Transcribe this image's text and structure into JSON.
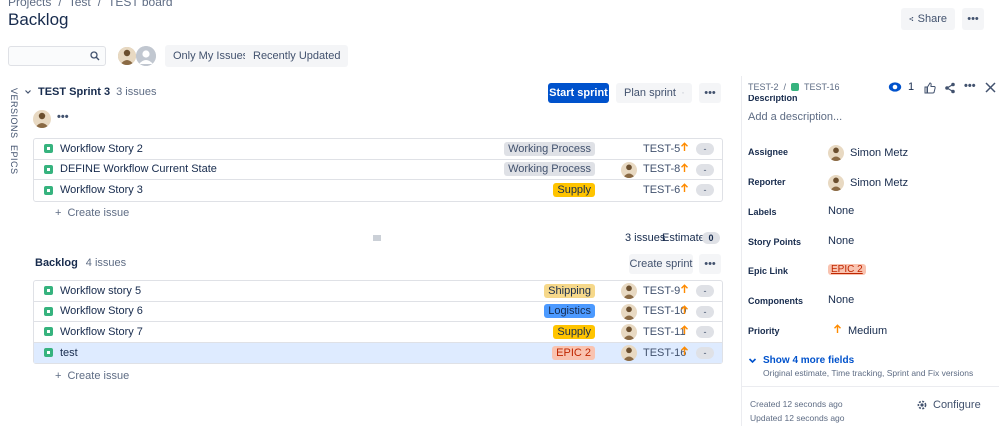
{
  "breadcrumb": [
    "Projects",
    "Test",
    "TEST board"
  ],
  "page_title": "Backlog",
  "header": {
    "share_label": "Share",
    "more_label": "•••"
  },
  "filters": {
    "search_placeholder": "",
    "only_my_issues": "Only My Issues",
    "recently_updated": "Recently Updated"
  },
  "side_tabs": {
    "versions": "VERSIONS",
    "epics": "EPICS"
  },
  "sprint": {
    "name": "TEST Sprint 3",
    "count": "3 issues",
    "start_label": "Start sprint",
    "plan_label": "Plan sprint",
    "more_label": "•••",
    "issues": [
      {
        "title": "Workflow Story 2",
        "epic": "Working Process",
        "epic_bg": "#dfe1e6",
        "epic_fg": "#42526e",
        "key": "TEST-5",
        "has_avatar": false,
        "estimate": "-"
      },
      {
        "title": "DEFINE Workflow Current State",
        "epic": "Working Process",
        "epic_bg": "#dfe1e6",
        "epic_fg": "#42526e",
        "key": "TEST-8",
        "has_avatar": true,
        "estimate": "-"
      },
      {
        "title": "Workflow Story 3",
        "epic": "Supply",
        "epic_bg": "#ffc400",
        "epic_fg": "#172b4d",
        "key": "TEST-6",
        "has_avatar": false,
        "estimate": "-"
      }
    ],
    "create_issue": "Create issue",
    "footer_count": "3 issues",
    "estimate_label": "Estimate",
    "estimate_total": "0"
  },
  "backlog": {
    "name": "Backlog",
    "count": "4 issues",
    "create_sprint_label": "Create sprint",
    "more_label": "•••",
    "issues": [
      {
        "title": "Workflow story 5",
        "epic": "Shipping",
        "epic_bg": "#f6d88a",
        "epic_fg": "#172b4d",
        "key": "TEST-9",
        "has_avatar": true,
        "estimate": "-"
      },
      {
        "title": "Workflow Story 6",
        "epic": "Logistics",
        "epic_bg": "#4c9aff",
        "epic_fg": "#172b4d",
        "key": "TEST-10",
        "has_avatar": true,
        "estimate": "-"
      },
      {
        "title": "Workflow Story 7",
        "epic": "Supply",
        "epic_bg": "#ffc400",
        "epic_fg": "#172b4d",
        "key": "TEST-11",
        "has_avatar": true,
        "estimate": "-"
      },
      {
        "title": "test",
        "epic": "EPIC 2",
        "epic_bg": "#f9c3b0",
        "epic_fg": "#bf2600",
        "key": "TEST-16",
        "has_avatar": true,
        "estimate": "-",
        "selected": true
      }
    ],
    "create_issue": "Create issue"
  },
  "detail": {
    "parent_key": "TEST-2",
    "issue_key": "TEST-16",
    "watch_count": "1",
    "description_label": "Description",
    "add_description": "Add a description...",
    "fields": [
      {
        "label": "Assignee",
        "value": "Simon Metz",
        "avatar": true
      },
      {
        "label": "Reporter",
        "value": "Simon Metz",
        "avatar": true
      },
      {
        "label": "Labels",
        "value": "None"
      },
      {
        "label": "Story Points",
        "value": "None"
      },
      {
        "label": "Epic Link",
        "value": "EPIC 2",
        "epic": true
      },
      {
        "label": "Components",
        "value": "None"
      },
      {
        "label": "Priority",
        "value": "Medium",
        "priority": true
      }
    ],
    "show_more": "Show 4 more fields",
    "show_more_sub": "Original estimate, Time tracking, Sprint and Fix versions",
    "created": "Created 12 seconds ago",
    "updated": "Updated 12 seconds ago",
    "configure": "Configure"
  },
  "colors": {
    "primary": "#0052cc",
    "story": "#36b37e",
    "priority": "#ff8b00",
    "selected": "#deebff"
  }
}
